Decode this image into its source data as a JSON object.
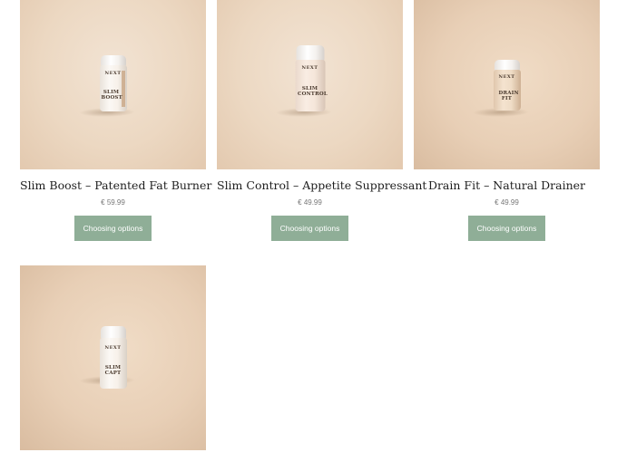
{
  "products": [
    {
      "title": "Slim Boost – Patented Fat Burner",
      "price": "€ 59.99",
      "button": "Choosing options",
      "bottle_brand": "NEXT",
      "bottle_name": "SLIM BOOST"
    },
    {
      "title": "Slim Control – Appetite Suppressant",
      "price": "€ 49.99",
      "button": "Choosing options",
      "bottle_brand": "NEXT",
      "bottle_name": "SLIM CONTROL"
    },
    {
      "title": "Drain Fit – Natural Drainer",
      "price": "€ 49.99",
      "button": "Choosing options",
      "bottle_brand": "NEXT",
      "bottle_name": "DRAIN FIT"
    },
    {
      "title": "",
      "price": "",
      "button": "",
      "bottle_brand": "NEXT",
      "bottle_name": "SLIM CAPT"
    }
  ],
  "colors": {
    "button_bg": "#8fae97",
    "button_text": "#ffffff",
    "photo_bg": "#ecd8c2"
  }
}
